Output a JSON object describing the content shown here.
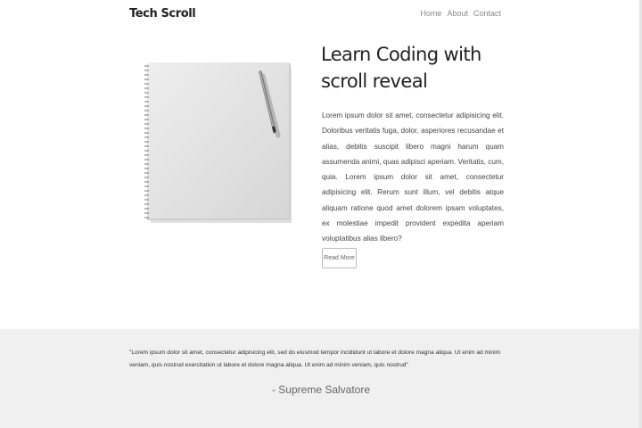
{
  "nav": {
    "brand": "Tech Scroll",
    "links": [
      "Home",
      "About",
      "Contact"
    ]
  },
  "hero": {
    "title": "Learn Coding with scroll reveal",
    "paragraph": "Lorem ipsum dolor sit amet, consectetur adipisicing elit. Doloribus veritatis fuga, dolor, asperiores recusandae et alias, debitis suscipit libero magni harum quam assumenda animi, quas adipisci aperiam. Veritatis, cum, quia. Lorem ipsum dolor sit amet, consectetur adipisicing elit. Rerum sunt illum, vel debitis atque aliquam ratione quod amet dolorem ipsam voluptates, ex molestiae impedit provident expedita aperiam voluptatibus alias libero?",
    "button_label": "Read More"
  },
  "quote": {
    "text": "\"Lorem ipsum dolor sit amet, consectetur adipisicing elit, sed do eiusmod tempor incididunt ut labore et dolore magna aliqua. Ut enim ad minim veniam, quis nostrud exercitation ut labore et dolore magna aliqua. Ut enim ad minim veniam, quis nostrud\"",
    "author": "- Supreme Salvatore"
  },
  "colors": {
    "quote_background": "#f0f0f0",
    "brand_text": "#222222"
  }
}
